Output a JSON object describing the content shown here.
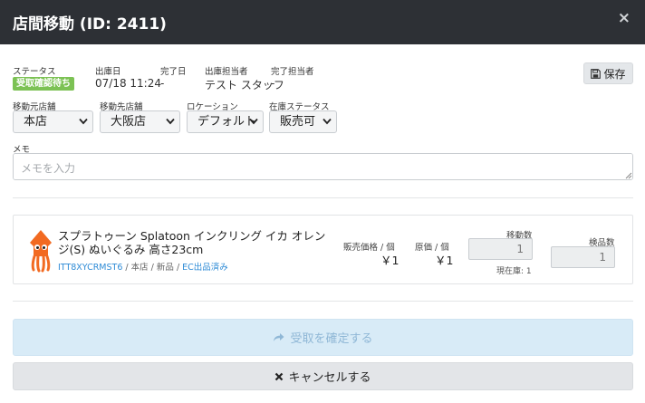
{
  "modal": {
    "title": "店間移動 (ID: 2411)",
    "close_glyph": "×"
  },
  "info": {
    "status_label": "ステータス",
    "status_badge": "受取確認待ち",
    "shipped_date_label": "出庫日",
    "shipped_date_value": "07/18 11:24",
    "completed_date_label": "完了日",
    "completed_date_value": "-",
    "shipper_label": "出庫担当者",
    "shipper_value": "テスト スタッフ",
    "completer_label": "完了担当者",
    "completer_value": "-"
  },
  "toolbar": {
    "save_label": "保存"
  },
  "selects": {
    "from_store_label": "移動元店舗",
    "from_store_value": "本店",
    "to_store_label": "移動先店舗",
    "to_store_value": "大阪店",
    "location_label": "ロケーション",
    "location_value": "デフォルト",
    "stock_status_label": "在庫ステータス",
    "stock_status_value": "販売可"
  },
  "memo": {
    "label": "メモ",
    "placeholder": "メモを入力"
  },
  "item": {
    "name": "スプラトゥーン Splatoon インクリング イカ オレンジ(S) ぬいぐるみ 高さ23cm",
    "sku": "ITT8XYCRMST6",
    "meta_separator_1": " / ",
    "store": "本店",
    "meta_separator_2": " / ",
    "condition": "新品",
    "meta_separator_3": " / ",
    "ec_status": "EC出品済み",
    "sale_price_label": "販売価格 / 個",
    "sale_price_value": "￥1",
    "cost_label": "原価 / 個",
    "cost_value": "￥1",
    "transfer_qty_label": "移動数",
    "transfer_qty_value": "1",
    "current_stock_note": "現在庫: 1",
    "inspected_qty_label": "検品数",
    "inspected_qty_value": "1"
  },
  "actions": {
    "confirm_label": "受取を確定する",
    "cancel_label": "キャンセルする"
  },
  "colors": {
    "header_bg": "#2d3035",
    "badge_green": "#7cc254",
    "link_blue": "#2e8bd6",
    "confirm_bg": "#d8ebf7",
    "item_orange": "#f26a21"
  }
}
